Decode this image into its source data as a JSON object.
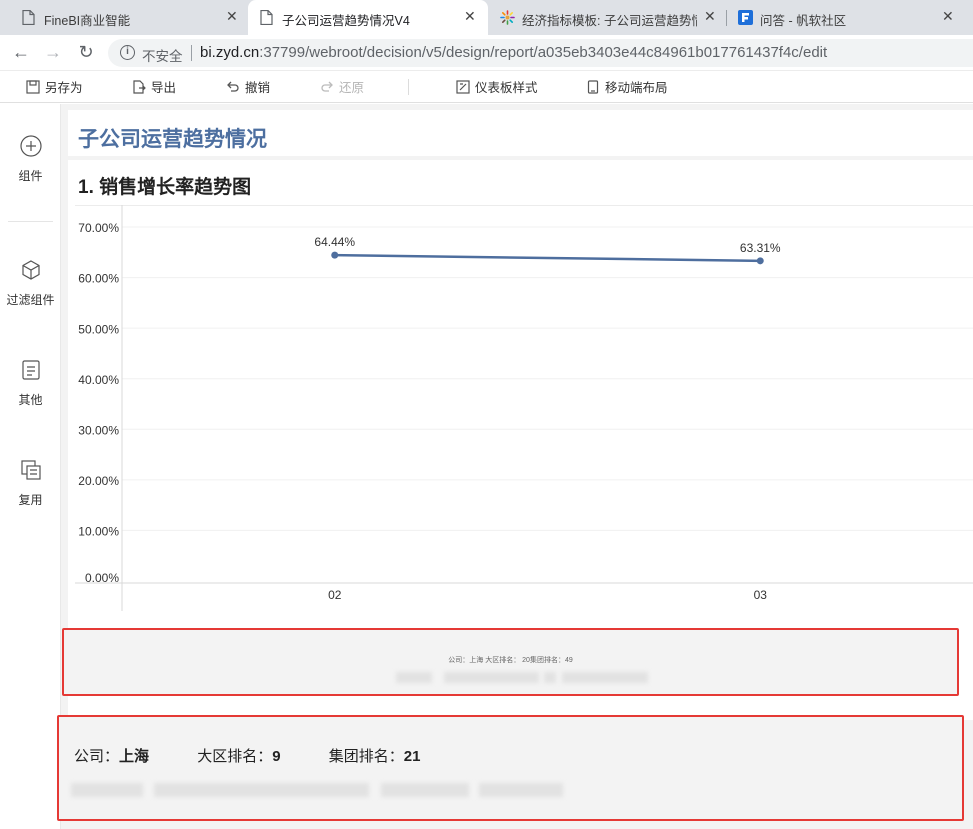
{
  "browser": {
    "tabs": [
      {
        "title": "FineBI商业智能",
        "icon": "page-icon",
        "active": false
      },
      {
        "title": "子公司运营趋势情况V4",
        "icon": "page-icon",
        "active": true
      },
      {
        "title": "经济指标模板: 子公司运营趋势情",
        "icon": "colorful-burst-icon",
        "active": false
      },
      {
        "title": "问答 - 帆软社区",
        "icon": "fanruan-logo-icon",
        "active": false
      }
    ],
    "close_glyph": "✕",
    "security_label": "不安全",
    "url_host": "bi.zyd.cn",
    "url_rest": ":37799/webroot/decision/v5/design/report/a035eb3403e44c84961b017761437f4c/edit"
  },
  "toolbar": {
    "save_as": "另存为",
    "export": "导出",
    "undo": "撤销",
    "redo": "还原",
    "dashboard_style": "仪表板样式",
    "mobile_layout": "移动端布局"
  },
  "sidebar": {
    "items": [
      {
        "label": "组件",
        "icon": "plus-circle-icon"
      },
      {
        "label": "过滤组件",
        "icon": "cube-icon"
      },
      {
        "label": "其他",
        "icon": "text-doc-icon"
      },
      {
        "label": "复用",
        "icon": "copy-layers-icon"
      }
    ]
  },
  "page": {
    "title": "子公司运营趋势情况",
    "widget_title": "1. 销售增长率趋势图"
  },
  "chart_data": {
    "type": "line",
    "categories": [
      "02",
      "03"
    ],
    "series": [
      {
        "values": [
          64.44,
          63.31
        ],
        "labels": [
          "64.44%",
          "63.31%"
        ]
      }
    ],
    "yticks": [
      "0.00%",
      "10.00%",
      "20.00%",
      "30.00%",
      "40.00%",
      "50.00%",
      "60.00%",
      "70.00%"
    ],
    "ylim": [
      0,
      70
    ],
    "line_color": "#4e6e9e",
    "grid": true
  },
  "box1": {
    "small_text": "公司：上海  大区排名：  20集团排名：49"
  },
  "box2": {
    "company_label": "公司：",
    "company_value": "上海",
    "region_label": "大区排名：",
    "region_value": "9",
    "group_label": "集团排名：",
    "group_value": "21"
  },
  "colors": {
    "title_blue": "#4d6fa0",
    "highlight_red": "#e53935",
    "tab_strip": "#dee1e6"
  }
}
